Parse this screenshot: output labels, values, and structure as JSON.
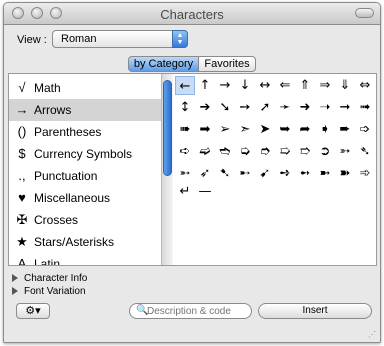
{
  "window": {
    "title": "Characters"
  },
  "view": {
    "label": "View :",
    "value": "Roman"
  },
  "tabs": {
    "by_category": "by Category",
    "favorites": "Favorites"
  },
  "categories": [
    {
      "icon": "√",
      "label": "Math"
    },
    {
      "icon": "→",
      "label": "Arrows"
    },
    {
      "icon": "()",
      "label": "Parentheses"
    },
    {
      "icon": "$",
      "label": "Currency Symbols"
    },
    {
      "icon": ".,",
      "label": "Punctuation"
    },
    {
      "icon": "♥",
      "label": "Miscellaneous"
    },
    {
      "icon": "✠",
      "label": "Crosses"
    },
    {
      "icon": "★",
      "label": "Stars/Asterisks"
    },
    {
      "icon": "A",
      "label": "Latin"
    }
  ],
  "glyph_rows": [
    [
      "←",
      "↑",
      "→",
      "↓",
      "↔",
      "⇐",
      "⇑",
      "⇒",
      "⇓",
      "⇔"
    ],
    [
      "↕",
      "➔",
      "➘",
      "➙",
      "➚",
      "➛",
      "➜",
      "➝",
      "➞",
      "➟"
    ],
    [
      "➠",
      "➡",
      "➢",
      "➣",
      "➤",
      "➥",
      "➦",
      "➧",
      "➨",
      "➩"
    ],
    [
      "➪",
      "➫",
      "➬",
      "➭",
      "➮",
      "➯",
      "➱",
      "➲",
      "➳",
      "➴"
    ],
    [
      "➵",
      "➶",
      "➷",
      "➸",
      "➹",
      "➺",
      "➻",
      "➼",
      "➽",
      "➾"
    ],
    [
      "↵",
      "—"
    ]
  ],
  "disclosures": {
    "character_info": "Character Info",
    "font_variation": "Font Variation"
  },
  "actions_menu": {
    "icon": "⚙▾"
  },
  "search": {
    "placeholder": "Description & code"
  },
  "insert_button": {
    "label": "Insert"
  }
}
